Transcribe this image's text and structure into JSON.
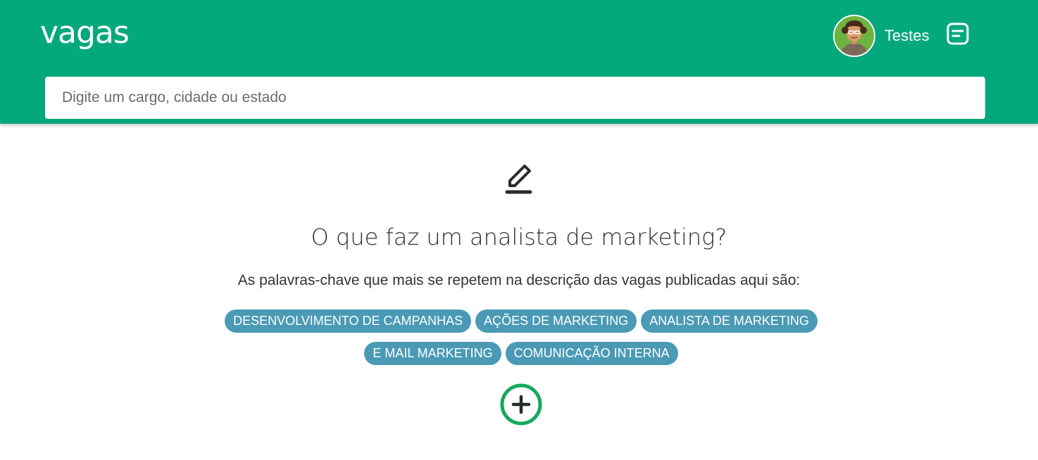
{
  "header": {
    "logo_text": "vagas",
    "user_name": "Testes",
    "brand_color": "#03a87c"
  },
  "search": {
    "placeholder": "Digite um cargo, cidade ou estado",
    "value": ""
  },
  "main": {
    "icon": "pencil-icon",
    "question": "O que faz um analista de marketing?",
    "subtitle": "As palavras-chave que mais se repetem na descrição das vagas publicadas aqui são:",
    "tags": [
      "DESENVOLVIMENTO DE CAMPANHAS",
      "AÇÕES DE MARKETING",
      "ANALISTA DE MARKETING",
      "E MAIL MARKETING",
      "COMUNICAÇÃO INTERNA"
    ],
    "tag_color": "#4a9ab5",
    "expand_icon": "plus-circle-icon",
    "expand_color": "#16a85e"
  }
}
